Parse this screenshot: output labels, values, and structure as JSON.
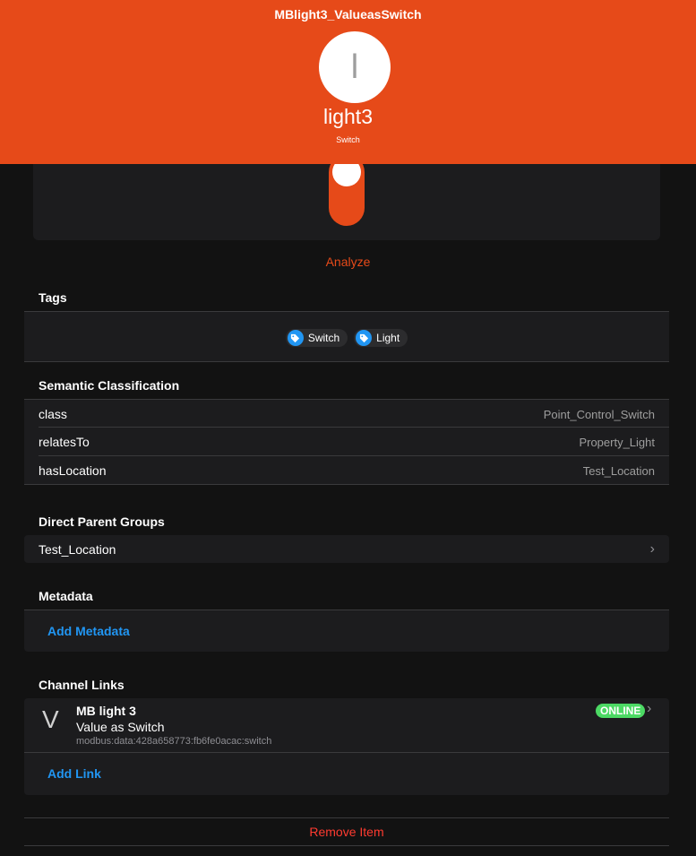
{
  "header": {
    "title": "MBlight3_ValueasSwitch",
    "avatar_letter": "l",
    "label": "light3",
    "type": "Switch"
  },
  "actions": {
    "analyze": "Analyze"
  },
  "tags": {
    "title": "Tags",
    "items": [
      {
        "label": "Switch"
      },
      {
        "label": "Light"
      }
    ]
  },
  "semantic": {
    "title": "Semantic Classification",
    "rows": [
      {
        "key": "class",
        "value": "Point_Control_Switch"
      },
      {
        "key": "relatesTo",
        "value": "Property_Light"
      },
      {
        "key": "hasLocation",
        "value": "Test_Location"
      }
    ]
  },
  "parents": {
    "title": "Direct Parent Groups",
    "items": [
      {
        "label": "Test_Location"
      }
    ]
  },
  "metadata": {
    "title": "Metadata",
    "add_label": "Add Metadata"
  },
  "channel_links": {
    "title": "Channel Links",
    "items": [
      {
        "icon_letter": "V",
        "thing": "MB light 3",
        "channel": "Value as Switch",
        "uid": "modbus:data:428a658773:fb6fe0acac:switch",
        "status": "ONLINE"
      }
    ],
    "add_label": "Add Link"
  },
  "remove": {
    "label": "Remove Item"
  },
  "colors": {
    "accent": "#e64a19",
    "link": "#2196f3",
    "online": "#4cd964",
    "danger": "#ff3b30"
  }
}
